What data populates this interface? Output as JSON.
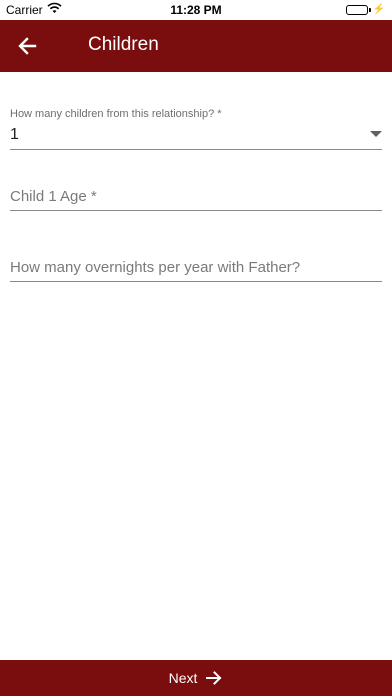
{
  "status_bar": {
    "carrier": "Carrier",
    "time": "11:28 PM",
    "battery_level_percent": 100
  },
  "app_bar": {
    "title": "Children",
    "background_color": "#7a0d0d",
    "back_icon": "arrow-left-icon"
  },
  "form": {
    "children_count": {
      "label": "How many children from this relationship?  *",
      "value": "1",
      "icon": "caret-down-icon"
    },
    "child_age": {
      "placeholder": "Child 1 Age *",
      "value": ""
    },
    "overnights": {
      "placeholder": "How many overnights per year with Father?",
      "value": ""
    }
  },
  "footer": {
    "next_label": "Next",
    "next_icon": "arrow-right-icon"
  }
}
